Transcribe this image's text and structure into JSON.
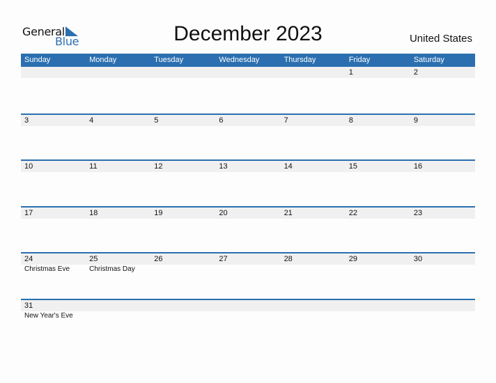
{
  "logo": {
    "word1": "General",
    "word2": "Blue"
  },
  "header": {
    "title": "December 2023",
    "country": "United States"
  },
  "colors": {
    "accent": "#2b6fb0",
    "day_strip": "#f0f0f0"
  },
  "weekdays": [
    "Sunday",
    "Monday",
    "Tuesday",
    "Wednesday",
    "Thursday",
    "Friday",
    "Saturday"
  ],
  "weeks": [
    {
      "days": [
        "",
        "",
        "",
        "",
        "",
        "1",
        "2"
      ],
      "holidays": [
        "",
        "",
        "",
        "",
        "",
        "",
        ""
      ]
    },
    {
      "days": [
        "3",
        "4",
        "5",
        "6",
        "7",
        "8",
        "9"
      ],
      "holidays": [
        "",
        "",
        "",
        "",
        "",
        "",
        ""
      ]
    },
    {
      "days": [
        "10",
        "11",
        "12",
        "13",
        "14",
        "15",
        "16"
      ],
      "holidays": [
        "",
        "",
        "",
        "",
        "",
        "",
        ""
      ]
    },
    {
      "days": [
        "17",
        "18",
        "19",
        "20",
        "21",
        "22",
        "23"
      ],
      "holidays": [
        "",
        "",
        "",
        "",
        "",
        "",
        ""
      ]
    },
    {
      "days": [
        "24",
        "25",
        "26",
        "27",
        "28",
        "29",
        "30"
      ],
      "holidays": [
        "Christmas Eve",
        "Christmas Day",
        "",
        "",
        "",
        "",
        ""
      ]
    },
    {
      "days": [
        "31",
        "",
        "",
        "",
        "",
        "",
        ""
      ],
      "holidays": [
        "New Year's Eve",
        "",
        "",
        "",
        "",
        "",
        ""
      ]
    }
  ]
}
